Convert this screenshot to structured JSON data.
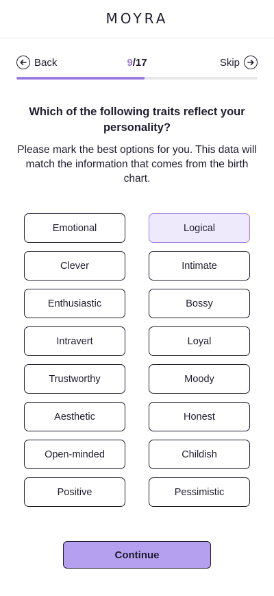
{
  "app": {
    "logo": "MOYRA"
  },
  "nav": {
    "back_label": "Back",
    "skip_label": "Skip",
    "step_current": "9",
    "step_total": "/17",
    "progress": 0.53
  },
  "question": {
    "title": "Which of the following traits reflect your personality?",
    "description": "Please mark the best options for you. This data will match the information that comes from the birth chart."
  },
  "traits": [
    {
      "label": "Emotional",
      "selected": false
    },
    {
      "label": "Logical",
      "selected": true
    },
    {
      "label": "Clever",
      "selected": false
    },
    {
      "label": "Intimate",
      "selected": false
    },
    {
      "label": "Enthusiastic",
      "selected": false
    },
    {
      "label": "Bossy",
      "selected": false
    },
    {
      "label": "Intravert",
      "selected": false
    },
    {
      "label": "Loyal",
      "selected": false
    },
    {
      "label": "Trustworthy",
      "selected": false
    },
    {
      "label": "Moody",
      "selected": false
    },
    {
      "label": "Aesthetic",
      "selected": false
    },
    {
      "label": "Honest",
      "selected": false
    },
    {
      "label": "Open-minded",
      "selected": false
    },
    {
      "label": "Childish",
      "selected": false
    },
    {
      "label": "Positive",
      "selected": false
    },
    {
      "label": "Pessimistic",
      "selected": false
    }
  ],
  "continue_label": "Continue",
  "colors": {
    "accent": "#9b7be0",
    "button": "#b5a0ef",
    "selected_bg": "#efeafb"
  }
}
